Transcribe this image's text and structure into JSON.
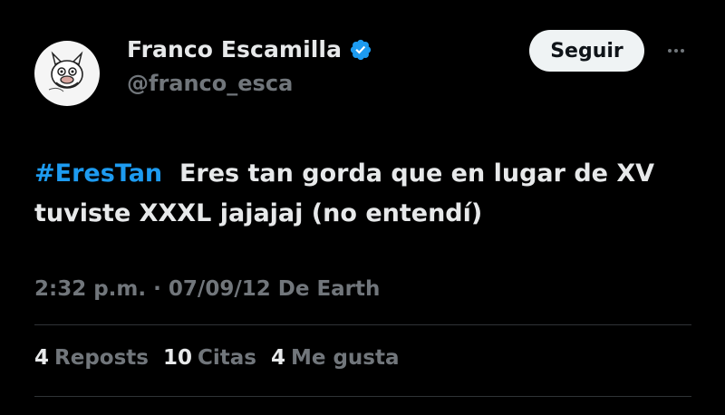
{
  "user": {
    "display_name": "Franco Escamilla",
    "handle": "@franco_esca",
    "verified": true,
    "avatar_icon": "cartoon-face-avatar"
  },
  "actions": {
    "follow_label": "Seguir",
    "more_icon": "more-horizontal-icon"
  },
  "tweet": {
    "hashtag": "#EresTan",
    "text_line1": "Eres tan gorda que en lugar de XV",
    "text_line2": "tuviste XXXL  jajajaj (no entendí)",
    "time": "2:32 p.m.",
    "separator": "·",
    "date": "07/09/12",
    "source": "De Earth"
  },
  "stats": [
    {
      "count": "4",
      "label": "Reposts"
    },
    {
      "count": "10",
      "label": "Citas"
    },
    {
      "count": "4",
      "label": "Me gusta"
    }
  ],
  "colors": {
    "background": "#000000",
    "text": "#e7e9ea",
    "muted": "#71767b",
    "accent": "#1d9bf0",
    "divider": "#2f3336",
    "button_bg": "#eff3f4"
  }
}
